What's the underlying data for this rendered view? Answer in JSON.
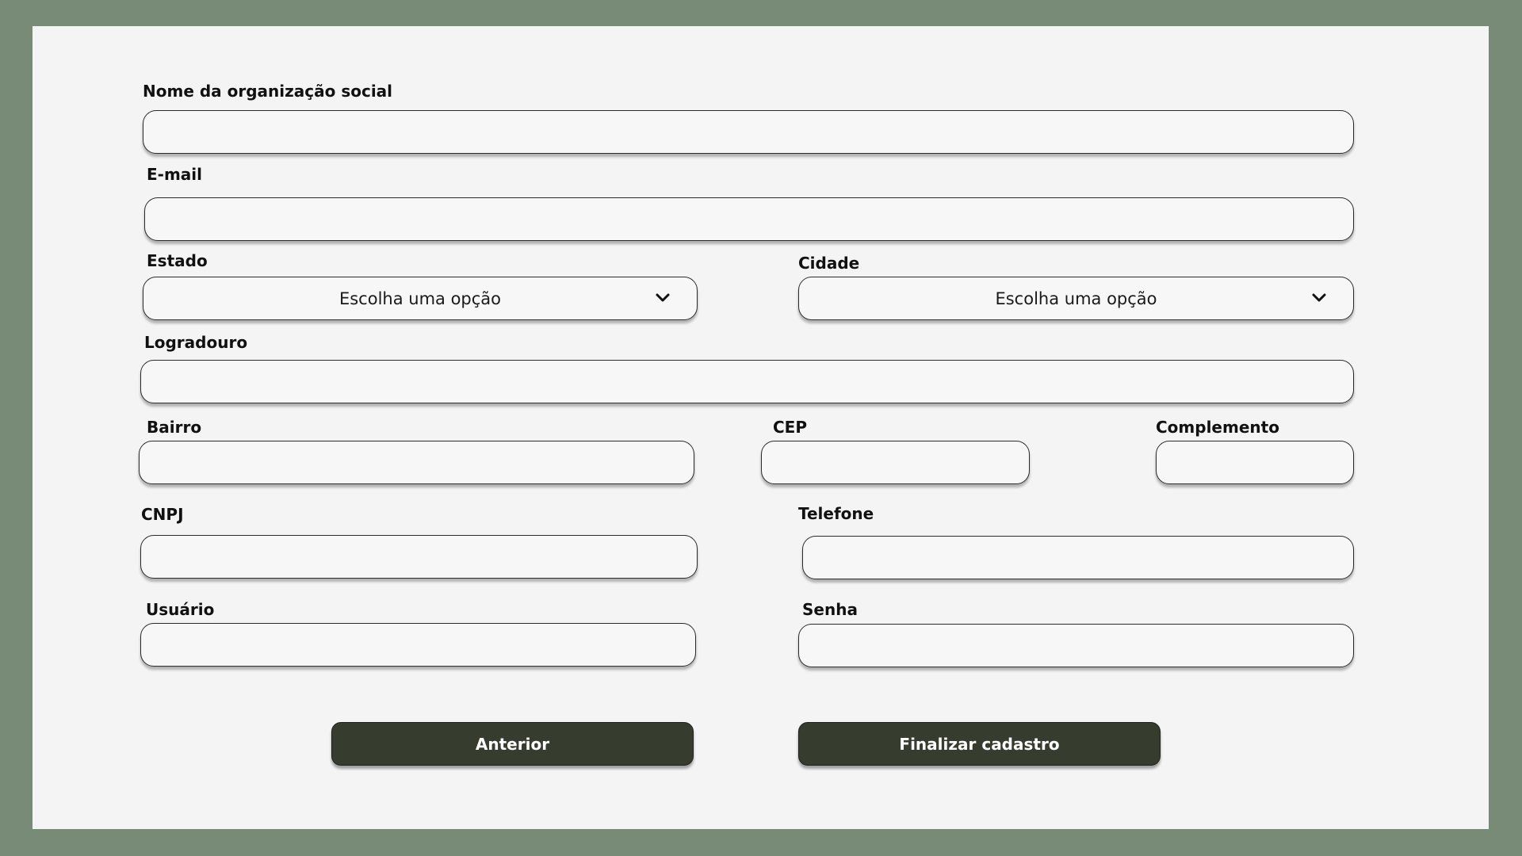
{
  "form": {
    "nome_label": "Nome da organização social",
    "email_label": "E-mail",
    "estado_label": "Estado",
    "estado_value": "Escolha uma opção",
    "cidade_label": "Cidade",
    "cidade_value": "Escolha uma opção",
    "logradouro_label": "Logradouro",
    "bairro_label": "Bairro",
    "cep_label": "CEP",
    "complemento_label": "Complemento",
    "cnpj_label": "CNPJ",
    "telefone_label": "Telefone",
    "usuario_label": "Usuário",
    "senha_label": "Senha"
  },
  "buttons": {
    "previous": "Anterior",
    "finish": "Finalizar cadastro"
  },
  "icons": {
    "select_chevron": "chevron-down-icon"
  },
  "colors": {
    "frame": "#778b76",
    "card": "#f4f4f4",
    "button": "#373d2e"
  }
}
